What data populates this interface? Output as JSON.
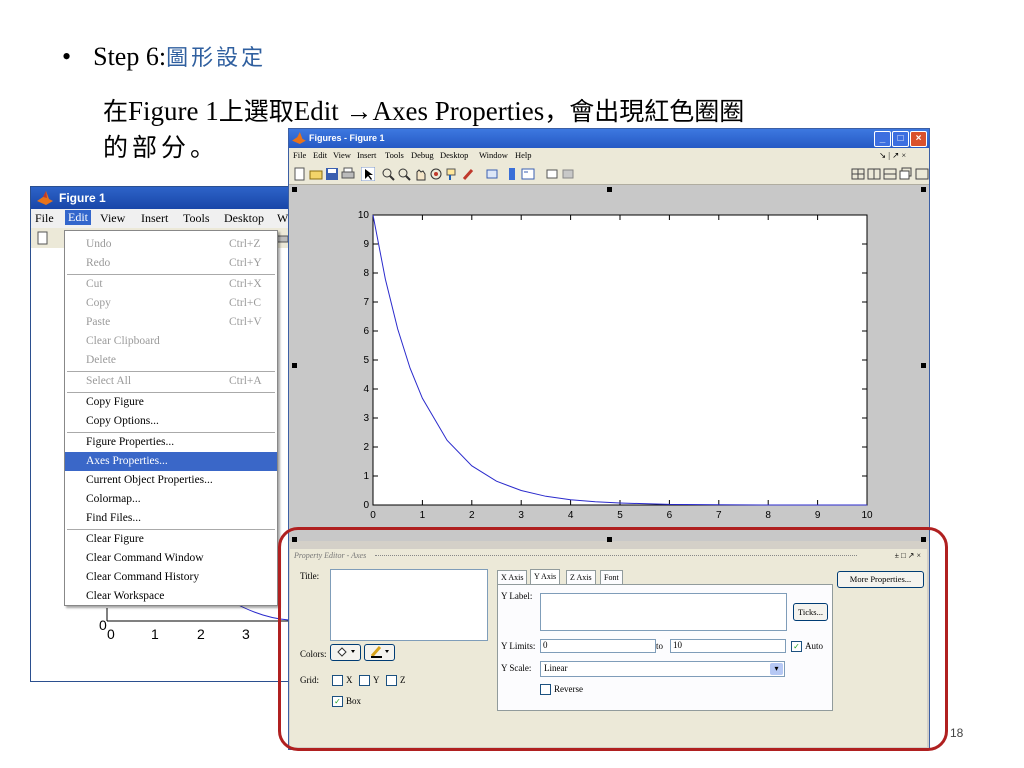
{
  "slide": {
    "bullet": "•",
    "step_label": "Step 6:",
    "step_title": "圖形設定",
    "line2_pre": "在",
    "line2_fig": "Figure 1",
    "line2_mid": "上選取",
    "line2_edit": "Edit →Axes Properties",
    "line2_post": "，會出現紅色圈圈",
    "line3": "的部分。",
    "slide_number": "18"
  },
  "left_window": {
    "title": "Figure 1",
    "menus": [
      "File",
      "Edit",
      "View",
      "Insert",
      "Tools",
      "Desktop",
      "W"
    ],
    "active_menu": "Edit",
    "axis_ticks": [
      "0",
      "1",
      "2",
      "3"
    ],
    "y_tick": "0"
  },
  "edit_menu": {
    "items": [
      {
        "label": "Undo",
        "shortcut": "Ctrl+Z",
        "disabled": true
      },
      {
        "label": "Redo",
        "shortcut": "Ctrl+Y",
        "disabled": true
      },
      {
        "label": "Cut",
        "shortcut": "Ctrl+X",
        "disabled": true
      },
      {
        "label": "Copy",
        "shortcut": "Ctrl+C",
        "disabled": true
      },
      {
        "label": "Paste",
        "shortcut": "Ctrl+V",
        "disabled": true
      },
      {
        "label": "Clear Clipboard",
        "shortcut": "",
        "disabled": true
      },
      {
        "label": "Delete",
        "shortcut": "",
        "disabled": true
      },
      {
        "label": "Select All",
        "shortcut": "Ctrl+A",
        "disabled": true
      },
      {
        "label": "Copy Figure",
        "shortcut": "",
        "disabled": false
      },
      {
        "label": "Copy Options...",
        "shortcut": "",
        "disabled": false
      },
      {
        "label": "Figure Properties...",
        "shortcut": "",
        "disabled": false
      },
      {
        "label": "Axes Properties...",
        "shortcut": "",
        "disabled": false,
        "highlighted": true
      },
      {
        "label": "Current Object Properties...",
        "shortcut": "",
        "disabled": false
      },
      {
        "label": "Colormap...",
        "shortcut": "",
        "disabled": false
      },
      {
        "label": "Find Files...",
        "shortcut": "",
        "disabled": false
      },
      {
        "label": "Clear Figure",
        "shortcut": "",
        "disabled": false
      },
      {
        "label": "Clear Command Window",
        "shortcut": "",
        "disabled": false
      },
      {
        "label": "Clear Command History",
        "shortcut": "",
        "disabled": false
      },
      {
        "label": "Clear Workspace",
        "shortcut": "",
        "disabled": false
      }
    ]
  },
  "right_window": {
    "title": "Figures - Figure 1",
    "menus": [
      "File",
      "Edit",
      "View",
      "Insert",
      "Tools",
      "Debug",
      "Desktop",
      "Window",
      "Help"
    ],
    "menu_right": "↘ | ↗ ×"
  },
  "chart_data": {
    "type": "line",
    "function_note": "",
    "x": [
      0,
      0.25,
      0.5,
      0.75,
      1,
      1.5,
      2,
      2.5,
      3,
      3.5,
      4,
      4.5,
      5,
      6,
      7,
      8,
      9,
      10
    ],
    "y": [
      10,
      7.79,
      6.07,
      4.72,
      3.68,
      2.23,
      1.35,
      0.82,
      0.5,
      0.3,
      0.18,
      0.11,
      0.07,
      0.02,
      0.01,
      0.0,
      0.0,
      0.0
    ],
    "xlim": [
      0,
      10
    ],
    "ylim": [
      0,
      10
    ],
    "xticks": [
      "0",
      "1",
      "2",
      "3",
      "4",
      "5",
      "6",
      "7",
      "8",
      "9",
      "10"
    ],
    "yticks": [
      "0",
      "1",
      "2",
      "3",
      "4",
      "5",
      "6",
      "7",
      "8",
      "9",
      "10"
    ],
    "line_color": "#2a2acc",
    "grid": false
  },
  "property_editor": {
    "header": "Property Editor - Axes",
    "header_buttons": "± □ ↗ ×",
    "title_label": "Title:",
    "colors_label": "Colors:",
    "grid_label": "Grid:",
    "grid_x": "X",
    "grid_y": "Y",
    "grid_z": "Z",
    "box_label": "Box",
    "tabs": [
      "X Axis",
      "Y Axis",
      "Z Axis",
      "Font"
    ],
    "active_tab": "Y Axis",
    "y_label_label": "Y Label:",
    "ticks_button": "Ticks...",
    "y_limits_label": "Y Limits:",
    "y_min": "0",
    "to_label": "to",
    "y_max": "10",
    "auto_label": "Auto",
    "y_scale_label": "Y Scale:",
    "y_scale_value": "Linear",
    "reverse_label": "Reverse",
    "more_properties": "More Properties..."
  }
}
